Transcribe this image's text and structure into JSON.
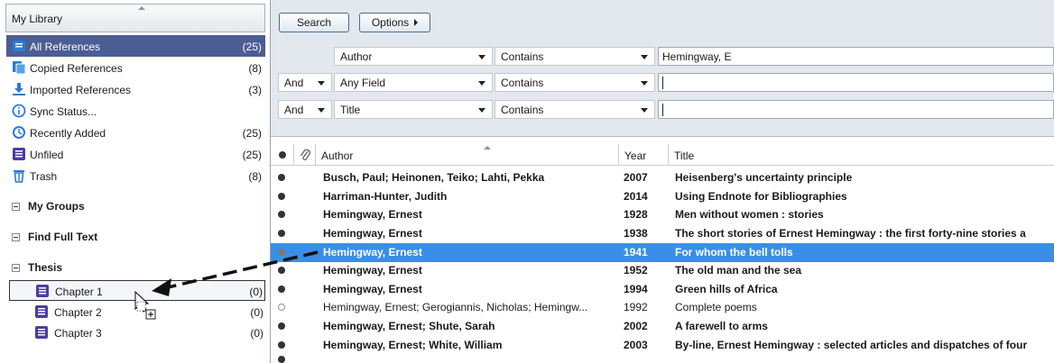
{
  "library": {
    "title": "My Library",
    "groups": [
      {
        "label": "All References",
        "count": "(25)",
        "icon": "book-icon"
      },
      {
        "label": "Copied References",
        "count": "(8)",
        "icon": "copied-icon"
      },
      {
        "label": "Imported References",
        "count": "(3)",
        "icon": "download-icon"
      },
      {
        "label": "Sync Status...",
        "count": "",
        "icon": "info-icon"
      },
      {
        "label": "Recently Added",
        "count": "(25)",
        "icon": "clock-icon"
      },
      {
        "label": "Unfiled",
        "count": "(25)",
        "icon": "book-icon"
      },
      {
        "label": "Trash",
        "count": "(8)",
        "icon": "trash-icon"
      }
    ],
    "sections": {
      "my_groups": "My Groups",
      "find_full_text": "Find Full Text",
      "thesis": "Thesis"
    },
    "thesis_items": [
      {
        "label": "Chapter 1",
        "count": "(0)"
      },
      {
        "label": "Chapter 2",
        "count": "(0)"
      },
      {
        "label": "Chapter 3",
        "count": "(0)"
      }
    ]
  },
  "toolbar": {
    "search_label": "Search",
    "options_label": "Options"
  },
  "search_rows": [
    {
      "bool": "",
      "field": "Author",
      "operator": "Contains",
      "value": "Hemingway, E"
    },
    {
      "bool": "And",
      "field": "Any Field",
      "operator": "Contains",
      "value": ""
    },
    {
      "bool": "And",
      "field": "Title",
      "operator": "Contains",
      "value": ""
    }
  ],
  "table": {
    "headers": {
      "author": "Author",
      "year": "Year",
      "title": "Title"
    },
    "rows": [
      {
        "author": "Busch, Paul; Heinonen, Teiko; Lahti, Pekka",
        "year": "2007",
        "title": "Heisenberg's uncertainty principle"
      },
      {
        "author": "Harriman-Hunter, Judith",
        "year": "2014",
        "title": "Using Endnote for Bibliographies"
      },
      {
        "author": "Hemingway, Ernest",
        "year": "1928",
        "title": "Men without women : stories"
      },
      {
        "author": "Hemingway, Ernest",
        "year": "1938",
        "title": "The short stories of Ernest Hemingway : the first forty-nine stories a"
      },
      {
        "author": "Hemingway, Ernest",
        "year": "1941",
        "title": "For whom the bell tolls"
      },
      {
        "author": "Hemingway, Ernest",
        "year": "1952",
        "title": "The old man and the sea"
      },
      {
        "author": "Hemingway, Ernest",
        "year": "1994",
        "title": "Green hills of Africa"
      },
      {
        "author": "Hemingway, Ernest; Gerogiannis, Nicholas; Hemingw...",
        "year": "1992",
        "title": "Complete poems"
      },
      {
        "author": "Hemingway, Ernest; Shute, Sarah",
        "year": "2002",
        "title": "A farewell to arms"
      },
      {
        "author": "Hemingway, Ernest; White, William",
        "year": "2003",
        "title": "By-line, Ernest Hemingway : selected articles and dispatches of four"
      }
    ]
  },
  "colors": {
    "selected_group": "#4c5d94",
    "selected_row": "#3a8ee8",
    "search_panel": "#e2e8ee"
  }
}
